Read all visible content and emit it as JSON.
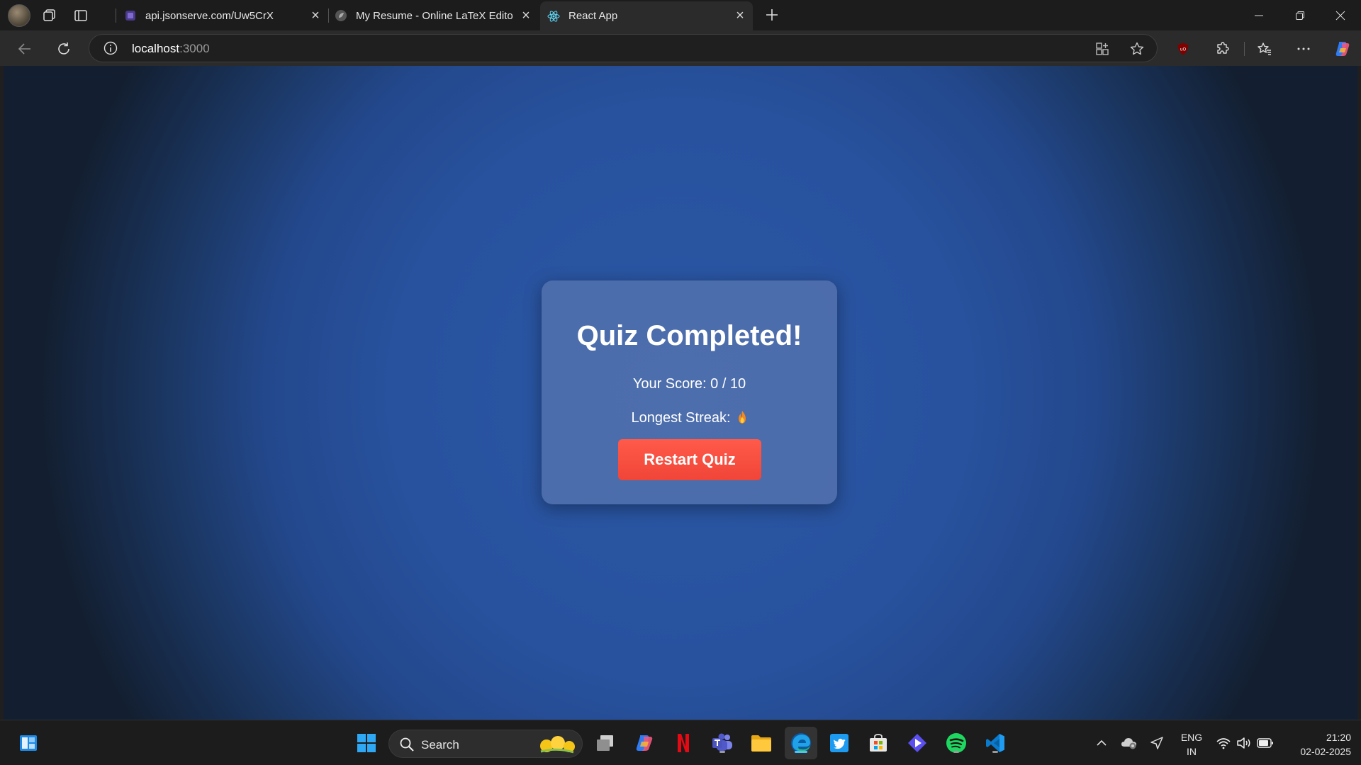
{
  "browser": {
    "tabs": [
      {
        "title": "api.jsonserve.com/Uw5CrX",
        "active": false
      },
      {
        "title": "My Resume - Online LaTeX Editor",
        "active": false
      },
      {
        "title": "React App",
        "active": true
      }
    ],
    "address": {
      "host": "localhost",
      "port": ":3000"
    }
  },
  "quiz": {
    "heading": "Quiz Completed!",
    "score_text": "Your Score: 0 / 10",
    "streak_label": "Longest Streak:",
    "restart_label": "Restart Quiz"
  },
  "taskbar": {
    "search_label": "Search",
    "language": {
      "line1": "ENG",
      "line2": "IN"
    },
    "clock": {
      "time": "21:20",
      "date": "02-02-2025"
    }
  },
  "colors": {
    "page_background": "#2a56a3",
    "restart_button": "#f04538",
    "accent": "#4cc2ff"
  },
  "icons": {
    "tabbar": [
      "workspaces-icon",
      "vertical-tabs-icon",
      "new-tab-icon",
      "minimize-icon",
      "restore-icon",
      "close-window-icon"
    ],
    "toolbar": [
      "back-icon",
      "refresh-icon",
      "info-icon",
      "app-available-icon",
      "favorite-star-icon",
      "ublock-icon",
      "extensions-icon",
      "favorites-icon",
      "more-icon",
      "copilot-icon"
    ],
    "taskbar": [
      "widgets-icon",
      "start-icon",
      "search-icon",
      "task-view-icon",
      "copilot-icon",
      "netflix-icon",
      "teams-icon",
      "file-explorer-icon",
      "edge-icon",
      "twitter-icon",
      "store-icon",
      "prime-video-icon",
      "spotify-icon",
      "vscode-icon"
    ],
    "tray": [
      "chevron-up-icon",
      "onedrive-icon",
      "location-icon",
      "wifi-icon",
      "volume-icon",
      "battery-icon"
    ]
  }
}
